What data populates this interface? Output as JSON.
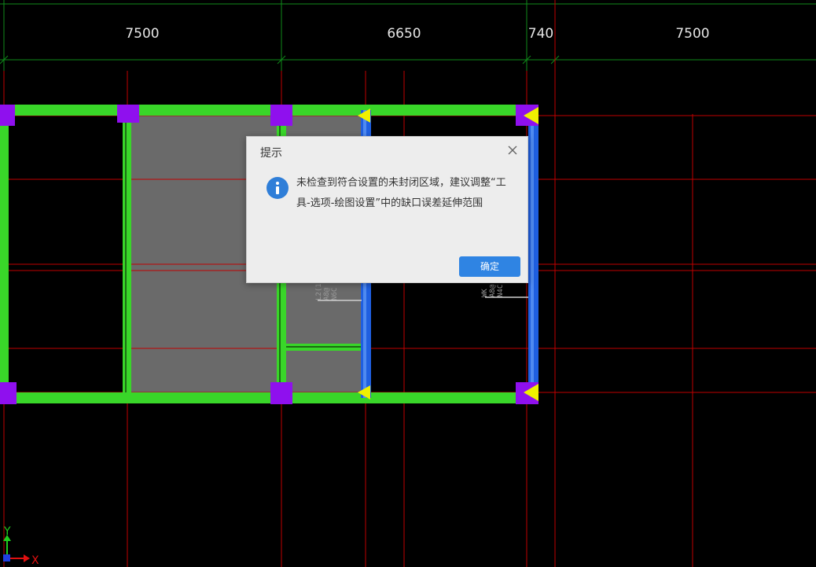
{
  "dimensions": [
    "7500",
    "6650",
    "740",
    "7500"
  ],
  "beam_labels": {
    "left": [
      "L2(1",
      "A8@",
      "N6C"
    ],
    "right": [
      "WK",
      "A8@",
      "N4C"
    ]
  },
  "axes": {
    "x_label": "X",
    "y_label": "Y"
  },
  "colors": {
    "beam": "#39d629",
    "column": "#8f10ee",
    "wall": "#1f5fe0",
    "slab": "#6a6a6a",
    "axis_line": "#c00000",
    "dim_line": "#0f8a1a",
    "marker": "#f0f000"
  },
  "dialog": {
    "title": "提示",
    "message": "未检查到符合设置的未封闭区域，建议调整“工具-选项-绘图设置”中的缺口误差延伸范围",
    "ok_label": "确定",
    "icon": "info-icon",
    "close_icon": "close-icon"
  }
}
